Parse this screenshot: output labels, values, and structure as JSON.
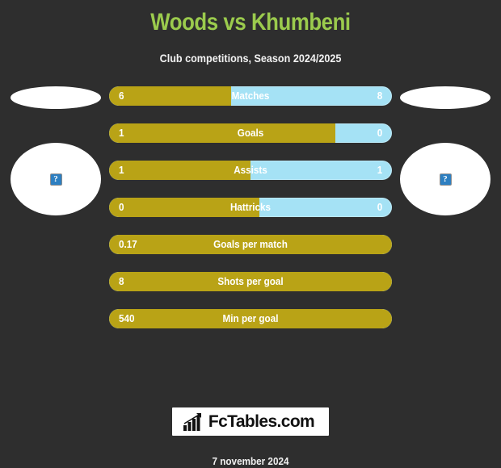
{
  "header": {
    "title": "Woods vs Khumbeni",
    "subtitle": "Club competitions, Season 2024/2025",
    "title_color": "#9bcb4d"
  },
  "teams": {
    "home": {
      "icon": "broken-image-icon",
      "glyph": "?"
    },
    "away": {
      "icon": "broken-image-icon",
      "glyph": "?"
    }
  },
  "colors": {
    "background": "#2e2e2e",
    "home_bar": "#b9a316",
    "away_bar": "#a5e2f5",
    "text": "#ffffff"
  },
  "chart_data": {
    "type": "bar",
    "title": "Woods vs Khumbeni",
    "subtitle": "Club competitions, Season 2024/2025",
    "categories": [
      "Matches",
      "Goals",
      "Assists",
      "Hattricks",
      "Goals per match",
      "Shots per goal",
      "Min per goal"
    ],
    "series": [
      {
        "name": "Woods",
        "values": [
          "6",
          "1",
          "1",
          "0",
          "0.17",
          "8",
          "540"
        ]
      },
      {
        "name": "Khumbeni",
        "values": [
          "8",
          "0",
          "1",
          "0",
          null,
          null,
          null
        ]
      }
    ],
    "legend": "none",
    "grid": false
  },
  "stats": [
    {
      "label": "Matches",
      "home": "6",
      "away": "8",
      "home_pct": 43,
      "split": true
    },
    {
      "label": "Goals",
      "home": "1",
      "away": "0",
      "home_pct": 80,
      "split": true
    },
    {
      "label": "Assists",
      "home": "1",
      "away": "1",
      "home_pct": 50,
      "split": true
    },
    {
      "label": "Hattricks",
      "home": "0",
      "away": "0",
      "home_pct": 53,
      "split": true
    },
    {
      "label": "Goals per match",
      "home": "0.17",
      "away": "",
      "home_pct": 100,
      "split": false
    },
    {
      "label": "Shots per goal",
      "home": "8",
      "away": "",
      "home_pct": 100,
      "split": false
    },
    {
      "label": "Min per goal",
      "home": "540",
      "away": "",
      "home_pct": 100,
      "split": false
    }
  ],
  "footer": {
    "logo_text": "FcTables.com",
    "logo_icon": "bar-chart-growth-icon",
    "date": "7 november 2024"
  }
}
